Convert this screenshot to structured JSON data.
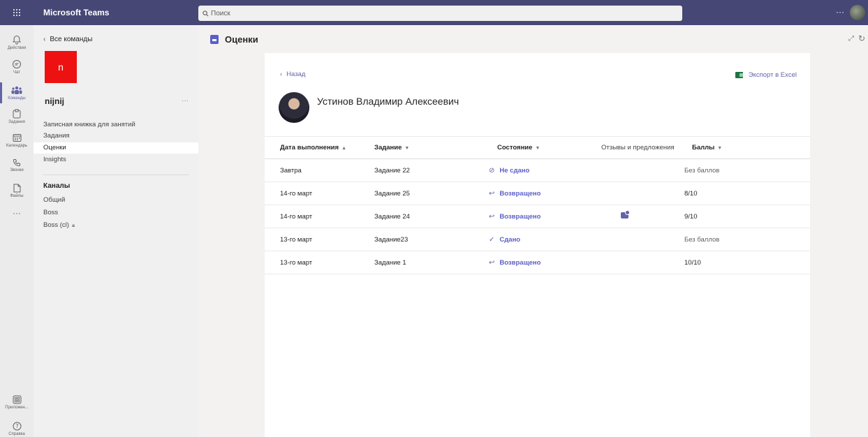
{
  "app": {
    "title": "Microsoft Teams"
  },
  "search": {
    "placeholder": "Поиск"
  },
  "rail": {
    "items": [
      {
        "label": "Действия",
        "icon": "bell-icon"
      },
      {
        "label": "Чат",
        "icon": "chat-icon"
      },
      {
        "label": "Команды",
        "icon": "teams-icon"
      },
      {
        "label": "Задания",
        "icon": "assignments-icon"
      },
      {
        "label": "Календарь",
        "icon": "calendar-icon"
      },
      {
        "label": "Звонки",
        "icon": "calls-icon"
      },
      {
        "label": "Файлы",
        "icon": "files-icon"
      }
    ],
    "more": "···",
    "apps_label": "Приложен...",
    "help_label": "Справка"
  },
  "team_panel": {
    "back_label": "Все команды",
    "tile_letter": "n",
    "team_name": "nijnij",
    "more": "···",
    "links": [
      "Записная книжка для занятий",
      "Задания",
      "Оценки",
      "Insights"
    ],
    "channels_heading": "Каналы",
    "channels": [
      "Общий",
      "Boss",
      "Boss (cl)"
    ]
  },
  "content": {
    "title": "Оценки",
    "back_label": "Назад",
    "export_label": "Экспорт в Excel",
    "student_name": "Устинов Владимир Алексеевич",
    "columns": {
      "due": "Дата выполнения",
      "assignment": "Задание",
      "status": "Состояние",
      "feedback": "Отзывы и предложения",
      "points": "Баллы"
    },
    "rows": [
      {
        "due": "Завтра",
        "assignment": "Задание 22",
        "status": "Не сдано",
        "status_icon": "not-submitted-icon",
        "points": "Без баллов",
        "feedback": false
      },
      {
        "due": "14-го март",
        "assignment": "Задание 25",
        "status": "Возвращено",
        "status_icon": "returned-icon",
        "points": "8/10",
        "feedback": false
      },
      {
        "due": "14-го март",
        "assignment": "Задание 24",
        "status": "Возвращено",
        "status_icon": "returned-icon",
        "points": "9/10",
        "feedback": true
      },
      {
        "due": "13-го март",
        "assignment": "Задание23",
        "status": "Сдано",
        "status_icon": "submitted-icon",
        "points": "Без баллов",
        "feedback": false
      },
      {
        "due": "13-го март",
        "assignment": "Задание 1",
        "status": "Возвращено",
        "status_icon": "returned-icon",
        "points": "10/10",
        "feedback": false
      }
    ]
  },
  "colors": {
    "brand": "#464775",
    "accent": "#6264a7",
    "team_tile": "#ee1111"
  }
}
